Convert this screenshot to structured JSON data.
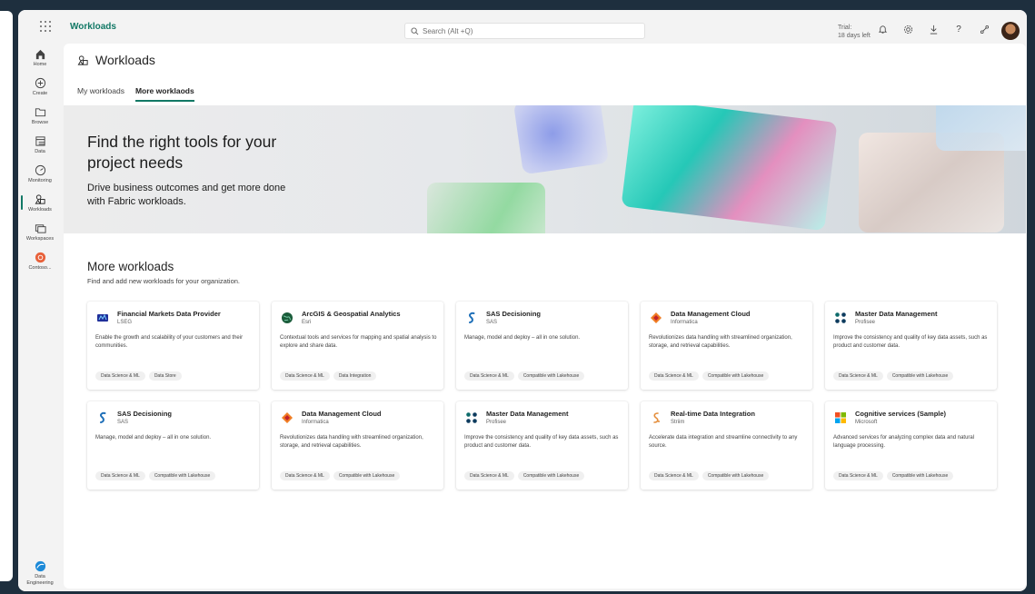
{
  "app": {
    "title": "Workloads"
  },
  "search": {
    "placeholder": "Search (Alt +Q)"
  },
  "trial": {
    "line1": "Trial:",
    "line2": "18 days left"
  },
  "topbar_icons": [
    "bell-icon",
    "gear-icon",
    "download-icon",
    "help-icon",
    "share-icon"
  ],
  "sidebar": {
    "items": [
      {
        "label": "Home",
        "icon": "home-icon"
      },
      {
        "label": "Create",
        "icon": "plus-circle-icon"
      },
      {
        "label": "Browse",
        "icon": "folder-icon"
      },
      {
        "label": "Data",
        "icon": "data-hub-icon"
      },
      {
        "label": "Monitoring",
        "icon": "monitor-icon"
      },
      {
        "label": "Workloads",
        "icon": "workloads-icon",
        "active": true
      },
      {
        "label": "Workspaces",
        "icon": "workspaces-icon"
      },
      {
        "label": "Contoso...",
        "icon": "contoso-icon"
      }
    ],
    "footer": {
      "line1": "Data",
      "line2": "Engineering"
    }
  },
  "page": {
    "title": "Workloads"
  },
  "tabs": [
    {
      "label": "My workloads",
      "active": false
    },
    {
      "label": "More worklaods",
      "active": true
    }
  ],
  "banner": {
    "headline": "Find the right tools for your project needs",
    "subtext": "Drive business outcomes and get more done with Fabric workloads."
  },
  "section": {
    "title": "More workloads",
    "subtitle": "Find and add new workloads for your organization."
  },
  "cards": [
    {
      "title": "Financial Markets Data Provider",
      "publisher": "LSEG",
      "icon": "lseg-icon",
      "description": "Enable the growth and scalability of your customers and their communities.",
      "tags": [
        "Data Science & ML",
        "Data Store"
      ]
    },
    {
      "title": "ArcGIS & Geospatial Analytics",
      "publisher": "Esri",
      "icon": "globe-icon",
      "description": "Contextual tools and services for mapping and spatial analysis to explore and share data.",
      "tags": [
        "Data Science & ML",
        "Data Integration"
      ]
    },
    {
      "title": "SAS Decisioning",
      "publisher": "SAS",
      "icon": "sas-icon",
      "description": "Manage, model and deploy – all in one solution.",
      "tags": [
        "Data Science & ML",
        "Compatible with Lakehouse"
      ]
    },
    {
      "title": "Data Management Cloud",
      "publisher": "Informatica",
      "icon": "informatica-icon",
      "description": "Revolutionizes data handling with streamlined organization, storage, and retrieval capabilities.",
      "tags": [
        "Data Science & ML",
        "Compatible with Lakehouse"
      ]
    },
    {
      "title": "Master Data Management",
      "publisher": "Profisee",
      "icon": "profisee-icon",
      "description": "Improve the consistency and quality of key data assets, such as product and customer data.",
      "tags": [
        "Data Science & ML",
        "Compatible with Lakehouse"
      ]
    },
    {
      "title": "SAS Decisioning",
      "publisher": "SAS",
      "icon": "sas-icon",
      "description": "Manage, model and deploy – all in one solution.",
      "tags": [
        "Data Science & ML",
        "Compatible with Lakehouse"
      ]
    },
    {
      "title": "Data Management Cloud",
      "publisher": "Informatica",
      "icon": "informatica-icon",
      "description": "Revolutionizes data handling with streamlined organization, storage, and retrieval capabilities.",
      "tags": [
        "Data Science & ML",
        "Compatible with Lakehouse"
      ]
    },
    {
      "title": "Master Data Management",
      "publisher": "Profisee",
      "icon": "profisee-icon",
      "description": "Improve the consistency and quality of key data assets, such as product and customer data.",
      "tags": [
        "Data Science & ML",
        "Compatible with Lakehouse"
      ]
    },
    {
      "title": "Real-time Data Integration",
      "publisher": "Striim",
      "icon": "striim-icon",
      "description": "Accelerate data integration and streamline connectivity to any source.",
      "tags": [
        "Data Science & ML",
        "Compatible with Lakehouse"
      ]
    },
    {
      "title": "Cognitive services (Sample)",
      "publisher": "Microsoft",
      "icon": "microsoft-icon",
      "description": "Advanced services for analyzing complex data and natural language processing.",
      "tags": [
        "Data Science & ML",
        "Compatible with Lakehouse"
      ]
    }
  ],
  "colors": {
    "accent": "#117865",
    "frame_bg": "#1e2f3e"
  }
}
